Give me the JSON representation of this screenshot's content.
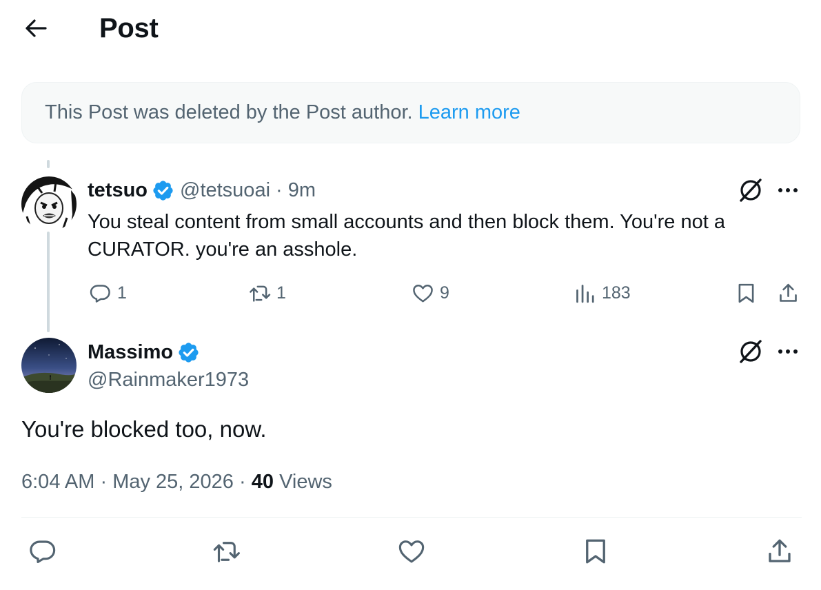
{
  "header": {
    "title": "Post",
    "back_icon": "arrow-left-icon"
  },
  "notice": {
    "text": "This Post was deleted by the Post author.",
    "link": "Learn more",
    "link_color": "#1d9bf0"
  },
  "reply": {
    "name": "tetsuo",
    "handle": "@tetsuoai",
    "separator": "·",
    "time": "9m",
    "verified": true,
    "text": "You steal content from small accounts and then block them. You're not a CURATOR. you're an asshole.",
    "stats": {
      "replies": "1",
      "reposts": "1",
      "likes": "9",
      "views": "183"
    }
  },
  "main": {
    "name": "Massimo",
    "handle": "@Rainmaker1973",
    "verified": true,
    "text": "You're blocked too, now.",
    "time": "6:04 AM",
    "date": "May 25, 2026",
    "separator": "·",
    "views_count": "40",
    "views_label": "Views"
  },
  "colors": {
    "verified": "#1d9bf0",
    "muted": "#536471",
    "text": "#0f1419"
  }
}
